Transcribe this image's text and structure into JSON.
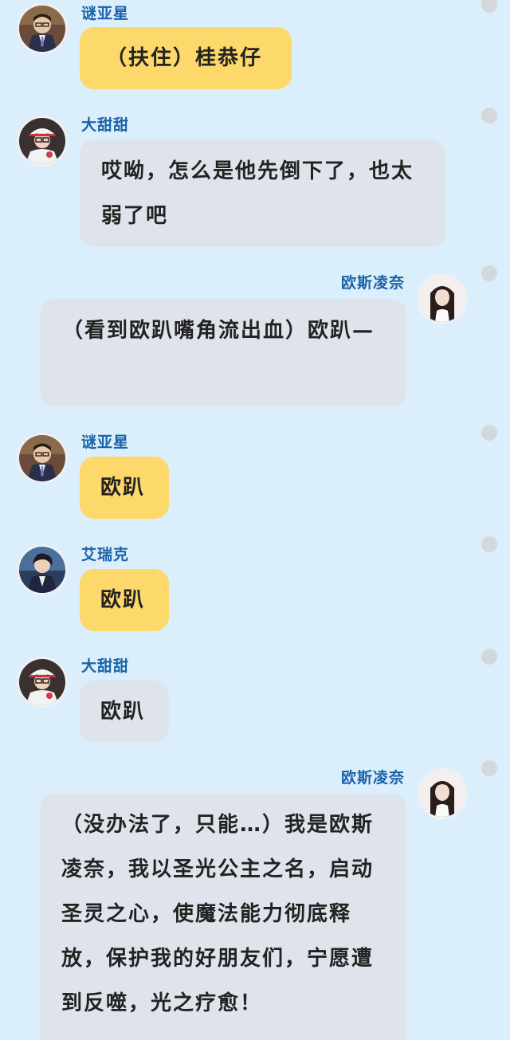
{
  "messages": [
    {
      "sender": "谜亚星",
      "text": "（扶住）桂恭仔",
      "style": "yellow",
      "side": "left",
      "avatar": "boy-glasses-icon"
    },
    {
      "sender": "大甜甜",
      "text": "哎呦，怎么是他先倒下了，也太弱了吧",
      "style": "gray",
      "side": "left",
      "avatar": "girl-hat-icon"
    },
    {
      "sender": "欧斯凌奈",
      "text": "（看到欧趴嘴角流出血）欧趴—",
      "style": "gray",
      "side": "right",
      "avatar": "girl-long-hair-icon"
    },
    {
      "sender": "谜亚星",
      "text": "欧趴",
      "style": "yellow",
      "side": "left",
      "avatar": "boy-glasses-icon"
    },
    {
      "sender": "艾瑞克",
      "text": "欧趴",
      "style": "yellow",
      "side": "left",
      "avatar": "boy-dark-hair-icon"
    },
    {
      "sender": "大甜甜",
      "text": "欧趴",
      "style": "gray",
      "side": "left",
      "avatar": "girl-hat-icon"
    },
    {
      "sender": "欧斯凌奈",
      "text": "（没办法了，只能…）我是欧斯凌奈，我以圣光公主之名，启动圣灵之心，使魔法能力彻底释放，保护我的好朋友们，宁愿遭到反噬，光之疗愈！",
      "style": "gray",
      "side": "right",
      "avatar": "girl-long-hair-icon"
    }
  ],
  "colors": {
    "background": "#dbeefb",
    "yellow_bubble": "#fdd86a",
    "gray_bubble": "#dfe4ec",
    "name": "#1b62a8"
  }
}
